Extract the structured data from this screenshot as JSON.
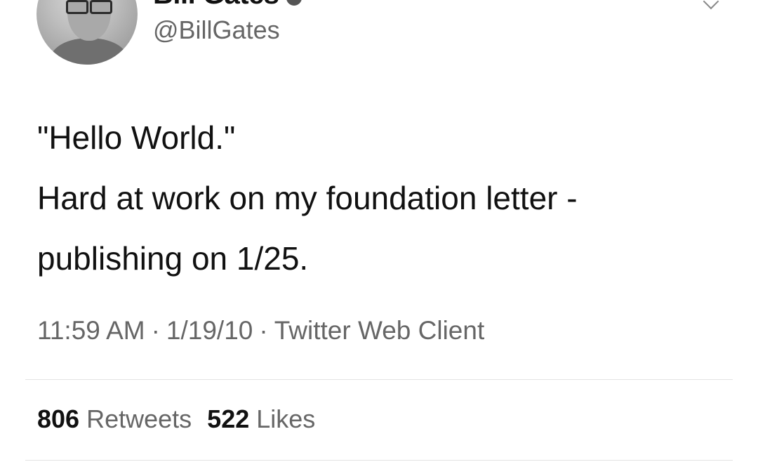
{
  "author": {
    "display_name": "Bill Gates",
    "handle": "@BillGates"
  },
  "tweet": {
    "lines": [
      "\"Hello World.\"",
      "Hard at work on my foundation letter -",
      "publishing on 1/25."
    ]
  },
  "meta": {
    "time": "11:59 AM",
    "date": "1/19/10",
    "separator": "·",
    "source": "Twitter Web Client"
  },
  "stats": {
    "retweets_count": "806",
    "retweets_label": "Retweets",
    "likes_count": "522",
    "likes_label": "Likes"
  },
  "icons": {
    "avatar": "profile-photo",
    "verified": "verified-badge-icon",
    "menu": "chevron-down-icon"
  }
}
